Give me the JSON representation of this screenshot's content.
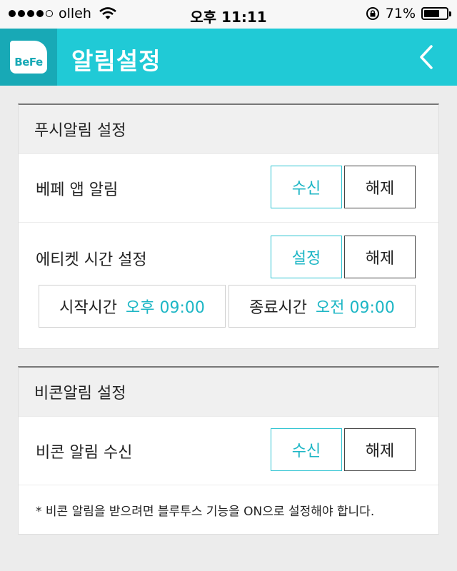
{
  "status_bar": {
    "carrier": "olleh",
    "time": "오후 11:11",
    "battery_percent": "71%",
    "battery_level": 0.71,
    "icons": [
      "signal-dots",
      "wifi-icon",
      "rotation-lock-icon",
      "battery-icon"
    ]
  },
  "header": {
    "logo_text": "BeFe",
    "title": "알림설정",
    "back_icon": "chevron-left-icon",
    "colors": {
      "bar": "#20cad6",
      "logo_bg": "#18a9b6"
    }
  },
  "push_section": {
    "title": "푸시알림 설정",
    "app_alert": {
      "label": "베페 앱 알림",
      "on_label": "수신",
      "off_label": "해제"
    },
    "etiquette": {
      "label": "에티켓 시간 설정",
      "on_label": "설정",
      "off_label": "해제"
    },
    "start_time": {
      "label": "시작시간",
      "value": "오후 09:00"
    },
    "end_time": {
      "label": "종료시간",
      "value": "오전 09:00"
    }
  },
  "beacon_section": {
    "title": "비콘알림 설정",
    "beacon_alert": {
      "label": "비콘 알림 수신",
      "on_label": "수신",
      "off_label": "해제"
    },
    "note": "* 비콘 알림을 받으려면 블루투스 기능을 ON으로 설정해야 합니다."
  },
  "accent_color": "#1db6c5"
}
